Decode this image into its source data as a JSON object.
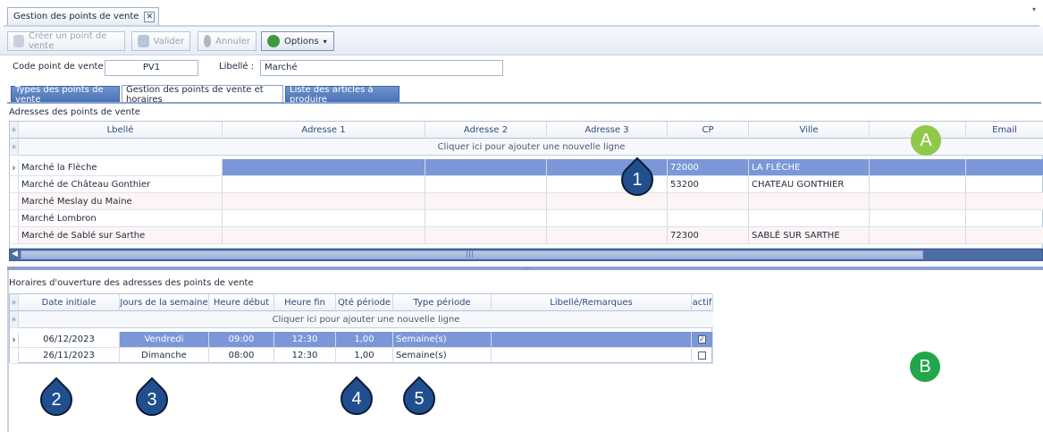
{
  "window": {
    "doc_tab_label": "Gestion des points de vente",
    "doc_tab_close": "✕"
  },
  "toolbar": {
    "create_label": "Créer un point de vente",
    "validate_label": "Valider",
    "cancel_label": "Annuler",
    "options_label": "Options"
  },
  "header": {
    "code_label": "Code point de vente :",
    "code_value": "PV1",
    "libelle_label": "Libellé :",
    "libelle_value": "Marché"
  },
  "tabs": [
    {
      "label": "Types des points de vente",
      "active": false
    },
    {
      "label": "Gestion des points de vente et horaires",
      "active": true
    },
    {
      "label": "Liste des articles à produire",
      "active": false
    }
  ],
  "addresses": {
    "title": "Adresses des points de vente",
    "add_row_text": "Cliquer ici pour ajouter une nouvelle ligne",
    "columns": [
      "Lbellé",
      "Adresse 1",
      "Adresse 2",
      "Adresse 3",
      "CP",
      "Ville",
      "",
      "Email"
    ],
    "rows": [
      [
        "Marché la Flèche",
        "",
        "",
        "",
        "72000",
        "LA FLÈCHE",
        "",
        ""
      ],
      [
        "Marché de Château Gonthier",
        "",
        "",
        "",
        "53200",
        "CHATEAU GONTHIER",
        "",
        ""
      ],
      [
        "Marché Meslay du Maine",
        "",
        "",
        "",
        "",
        "",
        "",
        ""
      ],
      [
        "Marché Lombron",
        "",
        "",
        "",
        "",
        "",
        "",
        ""
      ],
      [
        "Marché de Sablé sur Sarthe",
        "",
        "",
        "",
        "72300",
        "SABLÉ SUR SARTHE",
        "",
        ""
      ]
    ]
  },
  "hours": {
    "title": "Horaires d'ouverture des adresses des points de vente",
    "add_row_text": "Cliquer ici pour ajouter une nouvelle ligne",
    "columns": [
      "Date initiale",
      "Jours de la semaine",
      "Heure début",
      "Heure fin",
      "Qté période",
      "Type période",
      "Libellé/Remarques",
      "actif"
    ],
    "rows": [
      {
        "date": "06/12/2023",
        "jour": "Vendredi",
        "debut": "09:00",
        "fin": "12:30",
        "qte": "1,00",
        "type": "Semaine(s)",
        "remarques": "",
        "actif": true
      },
      {
        "date": "26/11/2023",
        "jour": "Dimanche",
        "debut": "08:00",
        "fin": "12:30",
        "qte": "1,00",
        "type": "Semaine(s)",
        "remarques": "",
        "actif": false
      }
    ]
  },
  "annotations": {
    "A": "A",
    "B": "B",
    "n1": "1",
    "n2": "2",
    "n3": "3",
    "n4": "4",
    "n5": "5"
  },
  "icons": {
    "row_pointer": "›",
    "indicator": "✳",
    "dropdown": "▾",
    "scroll_left": "◀",
    "scroll_grip": "|||"
  }
}
